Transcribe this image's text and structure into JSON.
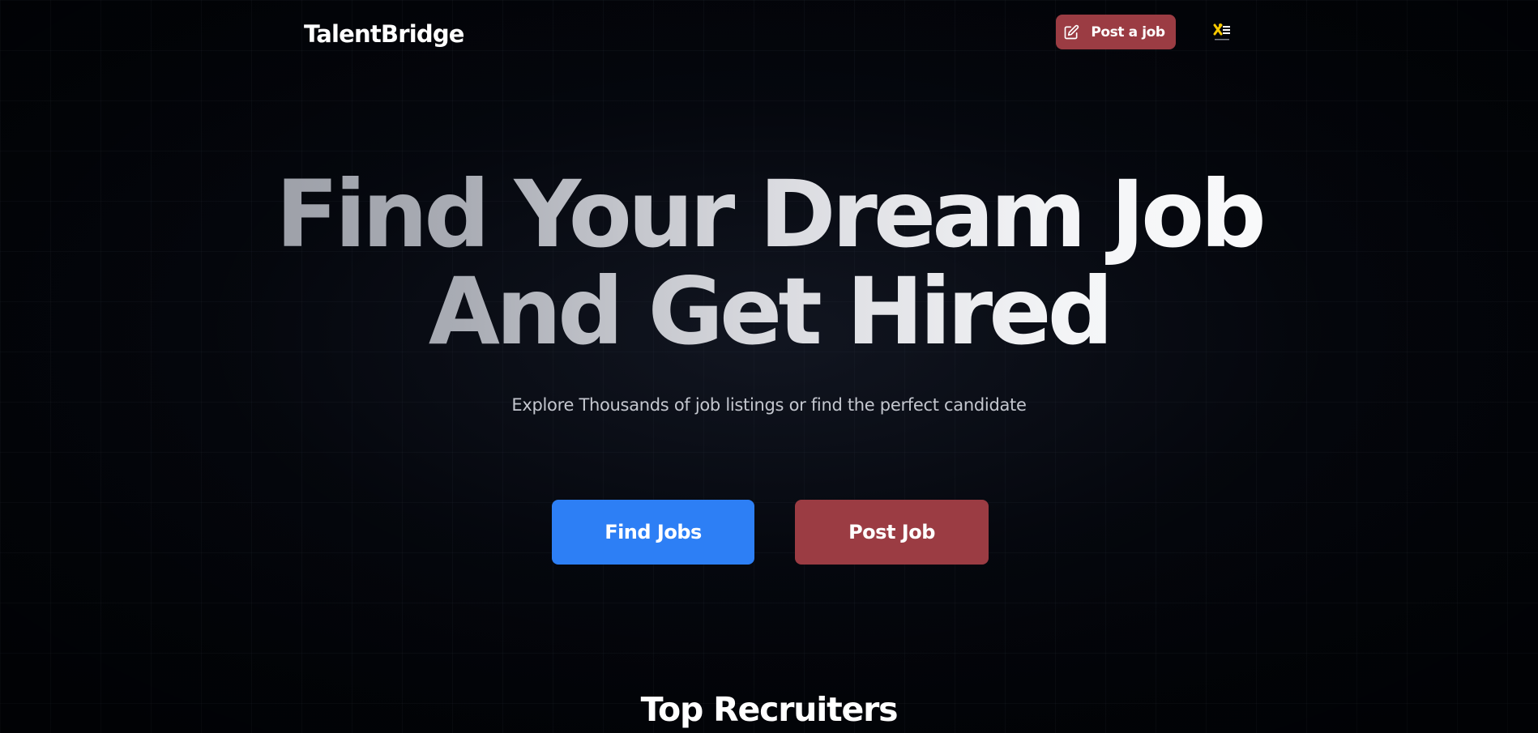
{
  "header": {
    "brand": "TalentBridge",
    "post_job_label": "Post a job",
    "post_job_icon": "edit-icon",
    "user_button_icon": "user-avatar-icon"
  },
  "hero": {
    "title_line1": "Find Your Dream Job",
    "title_line2": "And Get Hired",
    "subtitle": "Explore Thousands of job listings or find the perfect candidate"
  },
  "actions": {
    "find_jobs_label": "Find Jobs",
    "post_job_label": "Post Job"
  },
  "sections": {
    "top_recruiters_title": "Top Recruiters"
  },
  "colors": {
    "background": "#020409",
    "primary_blue": "#2d7ff5",
    "accent_red": "#9b3c43",
    "text_muted": "#c4c7cf",
    "user_icon_yellow": "#f6c800"
  }
}
